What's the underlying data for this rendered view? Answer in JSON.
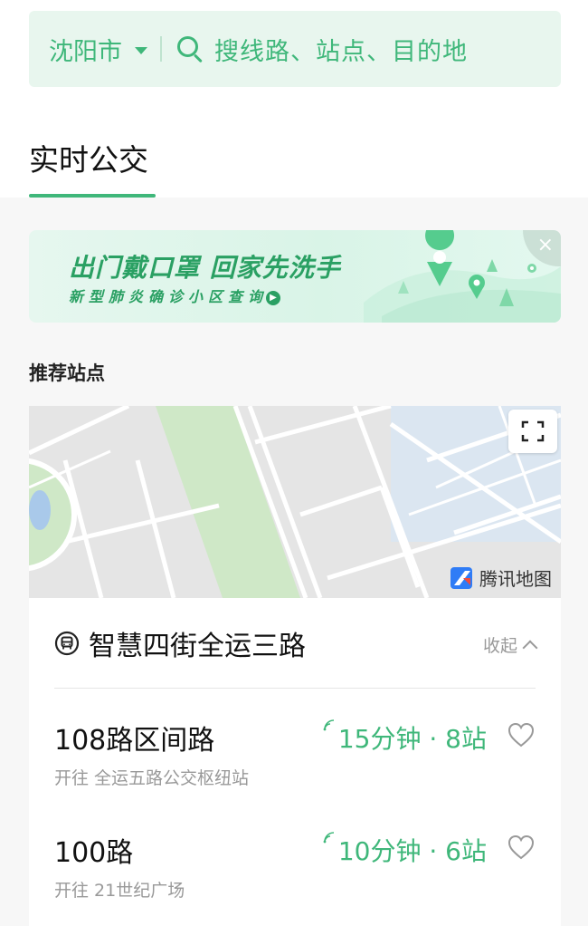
{
  "search": {
    "city": "沈阳市",
    "placeholder": "搜线路、站点、目的地"
  },
  "tabs": [
    {
      "label": "实时公交",
      "active": true
    }
  ],
  "banner": {
    "title": "出门戴口罩 回家先洗手",
    "subtitle": "新型肺炎确诊小区查询",
    "close_icon": "close-icon"
  },
  "recommend": {
    "section_title": "推荐站点"
  },
  "map": {
    "provider_label": "腾讯地图",
    "fullscreen_icon": "fullscreen-icon"
  },
  "stop": {
    "name": "智慧四街全运三路",
    "collapse_label": "收起",
    "routes": [
      {
        "name": "108路区间路",
        "direction": "开往 全运五路公交枢纽站",
        "eta": "15分钟 · 8站"
      },
      {
        "name": "100路",
        "direction": "开往 21世纪广场",
        "eta": "10分钟 · 6站"
      }
    ]
  },
  "colors": {
    "accent": "#3fb77a",
    "search_bg": "#e8f6ee",
    "page_bg": "#f7f7f7"
  }
}
